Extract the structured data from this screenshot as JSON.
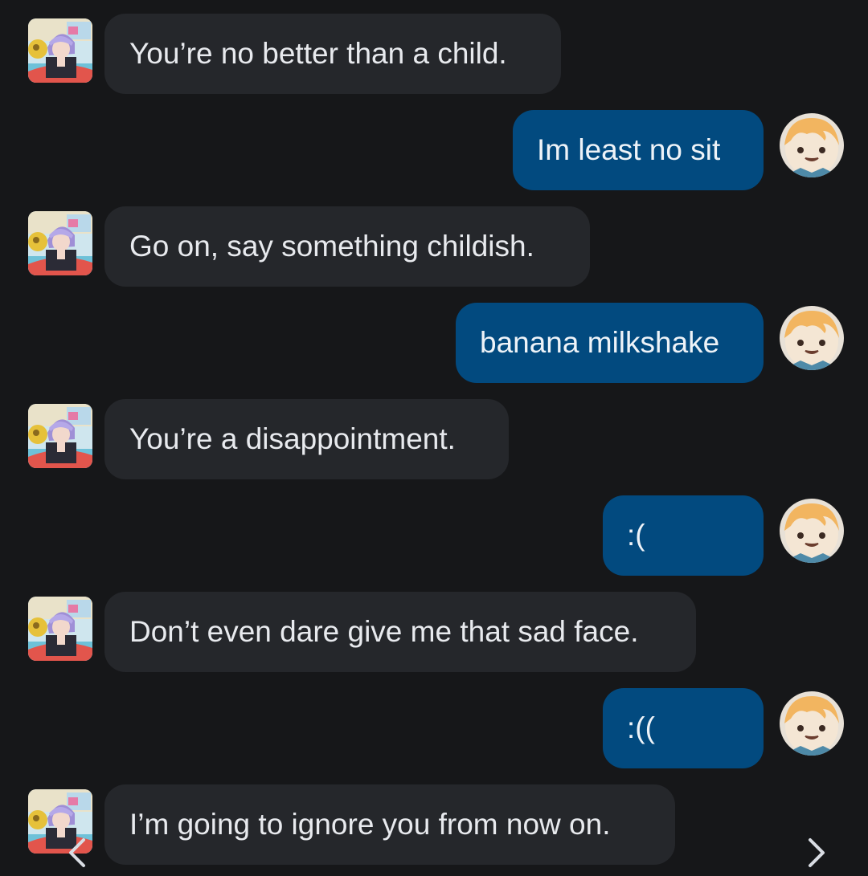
{
  "chat": {
    "messages": [
      {
        "role": "bot",
        "text": "You’re no better than a child.",
        "avatar": "purple-haired-character-avatar"
      },
      {
        "role": "user",
        "text": "Im least no sit",
        "avatar": "blonde-chibi-avatar"
      },
      {
        "role": "bot",
        "text": "Go on, say something childish.",
        "avatar": "purple-haired-character-avatar"
      },
      {
        "role": "user",
        "text": "banana milkshake",
        "avatar": "blonde-chibi-avatar"
      },
      {
        "role": "bot",
        "text": "You’re a disappointment.",
        "avatar": "purple-haired-character-avatar"
      },
      {
        "role": "user",
        "text": ":(",
        "avatar": "blonde-chibi-avatar"
      },
      {
        "role": "bot",
        "text": "Don’t even dare give me that sad face.",
        "avatar": "purple-haired-character-avatar"
      },
      {
        "role": "user",
        "text": ":((",
        "avatar": "blonde-chibi-avatar"
      },
      {
        "role": "bot",
        "text": "I’m going to ignore you from now on.",
        "avatar": "purple-haired-character-avatar"
      }
    ]
  },
  "navigation": {
    "prev_icon": "chevron-left-icon",
    "next_icon": "chevron-right-icon"
  },
  "colors": {
    "background": "#161719",
    "bot_bubble": "#25272b",
    "user_bubble": "#024a7f",
    "text": "#e8eaee"
  }
}
